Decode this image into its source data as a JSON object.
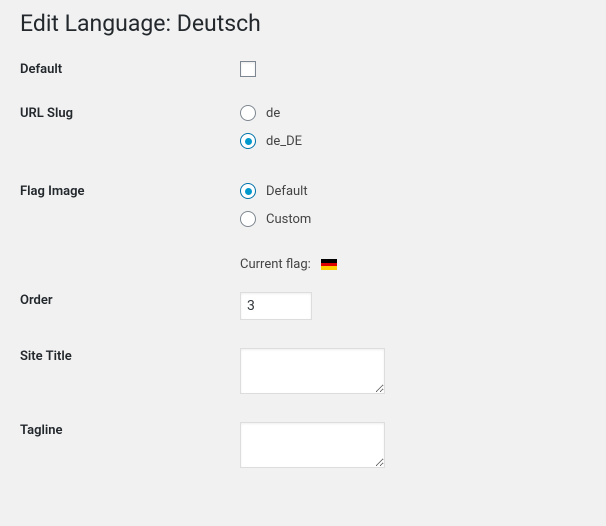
{
  "heading": "Edit Language: Deutsch",
  "fields": {
    "default_label": "Default",
    "url_slug_label": "URL Slug",
    "url_slug": {
      "option1": "de",
      "option2": "de_DE",
      "selected": "de_DE"
    },
    "flag_image_label": "Flag Image",
    "flag_image": {
      "option1": "Default",
      "option2": "Custom",
      "selected": "Default"
    },
    "current_flag_label": "Current flag:",
    "order_label": "Order",
    "order_value": "3",
    "site_title_label": "Site Title",
    "site_title_value": "",
    "tagline_label": "Tagline",
    "tagline_value": ""
  }
}
